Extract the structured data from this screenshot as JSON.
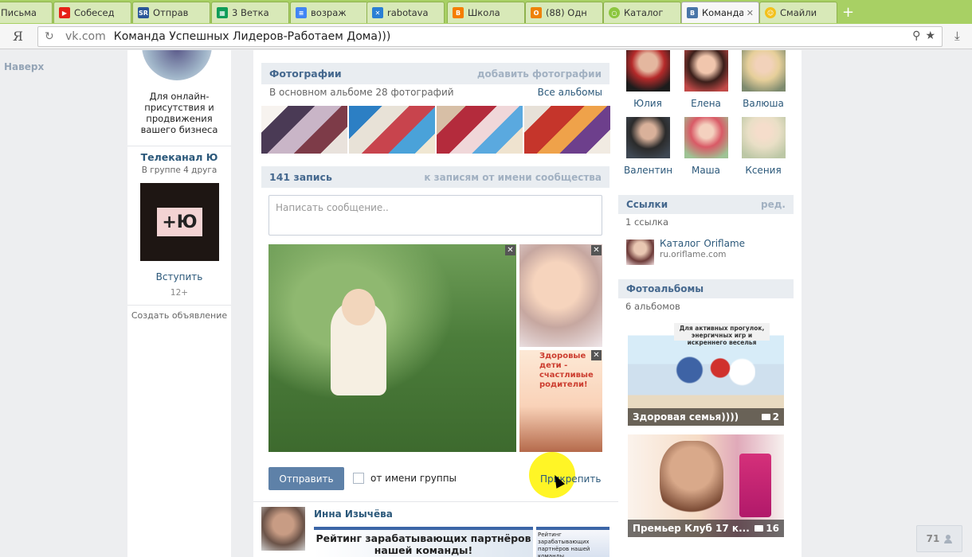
{
  "browser": {
    "tabs": [
      {
        "label": "Письма",
        "icon": "mail-icon",
        "color": "#3b5998"
      },
      {
        "label": "Собесед",
        "icon": "youtube-icon",
        "color": "#e62117"
      },
      {
        "label": "Отправ",
        "icon": "sr-icon",
        "color": "#2a5699"
      },
      {
        "label": "3 Ветка",
        "icon": "sheet-icon",
        "color": "#0f9d58"
      },
      {
        "label": "возраж",
        "icon": "doc-icon",
        "color": "#4285f4"
      },
      {
        "label": "rabotava",
        "icon": "x-site-icon",
        "color": "#2a7fd4"
      },
      {
        "label": "Школа",
        "icon": "blogger-icon",
        "color": "#f57d00"
      },
      {
        "label": "(88) Одн",
        "icon": "ok-icon",
        "color": "#ee8208"
      },
      {
        "label": "Каталог",
        "icon": "oriflame-icon",
        "color": "#8cc63f"
      },
      {
        "label": "Команда",
        "icon": "vk-icon",
        "color": "#4a76a8"
      },
      {
        "label": "Смайли",
        "icon": "smiley-icon",
        "color": "#f3c11b"
      }
    ],
    "ya_label": "Я",
    "url_host": "vk.com",
    "url_title": "Команда Успешных Лидеров-Работаем Дома)))"
  },
  "left": {
    "naverh": "Наверх",
    "ad_text": "Для онлайн-присутствия и продвижения вашего бизнеса",
    "tv_title": "Телеканал Ю",
    "tv_sub": "В группе 4 друга",
    "tv_logo_text": "+Ю",
    "join": "Вступить",
    "age": "12+",
    "create_ad": "Создать объявление"
  },
  "photos_section": {
    "title": "Фотографии",
    "add": "добавить фотографии",
    "album_info": "В основном альбоме 28 фотографий",
    "all_albums": "Все альбомы"
  },
  "wall": {
    "count": "141 запись",
    "community_link": "к записям от имени сообщества",
    "placeholder": "Написать сообщение..",
    "small_img_text": "Здоровые дети - счастливые родители!",
    "send": "Отправить",
    "as_group": "от имени группы",
    "attach": "Прикрепить"
  },
  "post": {
    "author": "Инна Изычёва",
    "image_text": "Рейтинг зарабатывающих партнёров нашей команды!",
    "image2_text": "Рейтинг зарабатывающих партнёров нашей команды"
  },
  "members": [
    {
      "name": "Юлия",
      "color": "#b52a2a"
    },
    {
      "name": "Елена",
      "color": "#c24a48"
    },
    {
      "name": "Валюша",
      "color": "#7d8a6e"
    },
    {
      "name": "Валентин",
      "color": "#3e4752"
    },
    {
      "name": "Маша",
      "color": "#d95a66"
    },
    {
      "name": "Ксения",
      "color": "#bcc7a5"
    }
  ],
  "links": {
    "title": "Ссылки",
    "edit": "ред.",
    "count": "1 ссылка",
    "item_title": "Каталог Oriflame",
    "item_domain": "ru.oriflame.com"
  },
  "albums": {
    "title": "Фотоальбомы",
    "count": "6 альбомов",
    "items": [
      {
        "caption": "Здоровая семья))))",
        "photos": "2",
        "top_text": "Для активных прогулок, энергичных игр и искреннего веселья"
      },
      {
        "caption": "Премьер Клуб 17 к...",
        "photos": "16"
      }
    ]
  },
  "counter": "71"
}
